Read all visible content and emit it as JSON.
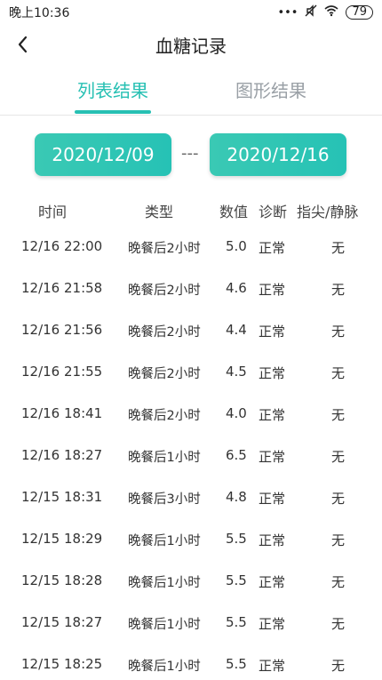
{
  "status_bar": {
    "time": "晚上10:36",
    "icons": [
      "more-icon",
      "mute-icon",
      "wifi-icon"
    ],
    "battery": "79"
  },
  "header": {
    "title": "血糖记录",
    "back_icon": "chevron-left-icon"
  },
  "tabs": [
    {
      "label": "列表结果",
      "active": true
    },
    {
      "label": "图形结果",
      "active": false
    }
  ],
  "date_range": {
    "start": "2020/12/09",
    "separator": "---",
    "end": "2020/12/16"
  },
  "table": {
    "headers": [
      "时间",
      "类型",
      "数值",
      "诊断",
      "指尖/静脉"
    ],
    "rows": [
      {
        "time": "12/16  22:00",
        "type": "晚餐后2小时",
        "value": "5.0",
        "diagnosis": "正常",
        "tip": "无"
      },
      {
        "time": "12/16  21:58",
        "type": "晚餐后2小时",
        "value": "4.6",
        "diagnosis": "正常",
        "tip": "无"
      },
      {
        "time": "12/16  21:56",
        "type": "晚餐后2小时",
        "value": "4.4",
        "diagnosis": "正常",
        "tip": "无"
      },
      {
        "time": "12/16  21:55",
        "type": "晚餐后2小时",
        "value": "4.5",
        "diagnosis": "正常",
        "tip": "无"
      },
      {
        "time": "12/16  18:41",
        "type": "晚餐后2小时",
        "value": "4.0",
        "diagnosis": "正常",
        "tip": "无"
      },
      {
        "time": "12/16  18:27",
        "type": "晚餐后1小时",
        "value": "6.5",
        "diagnosis": "正常",
        "tip": "无"
      },
      {
        "time": "12/15  18:31",
        "type": "晚餐后3小时",
        "value": "4.8",
        "diagnosis": "正常",
        "tip": "无"
      },
      {
        "time": "12/15  18:29",
        "type": "晚餐后1小时",
        "value": "5.5",
        "diagnosis": "正常",
        "tip": "无"
      },
      {
        "time": "12/15  18:28",
        "type": "晚餐后1小时",
        "value": "5.5",
        "diagnosis": "正常",
        "tip": "无"
      },
      {
        "time": "12/15  18:27",
        "type": "晚餐后1小时",
        "value": "5.5",
        "diagnosis": "正常",
        "tip": "无"
      },
      {
        "time": "12/15  18:25",
        "type": "晚餐后1小时",
        "value": "5.5",
        "diagnosis": "正常",
        "tip": "无"
      }
    ]
  },
  "colors": {
    "accent": "#27c0b3",
    "inactive_tab": "#9aa0a6"
  }
}
